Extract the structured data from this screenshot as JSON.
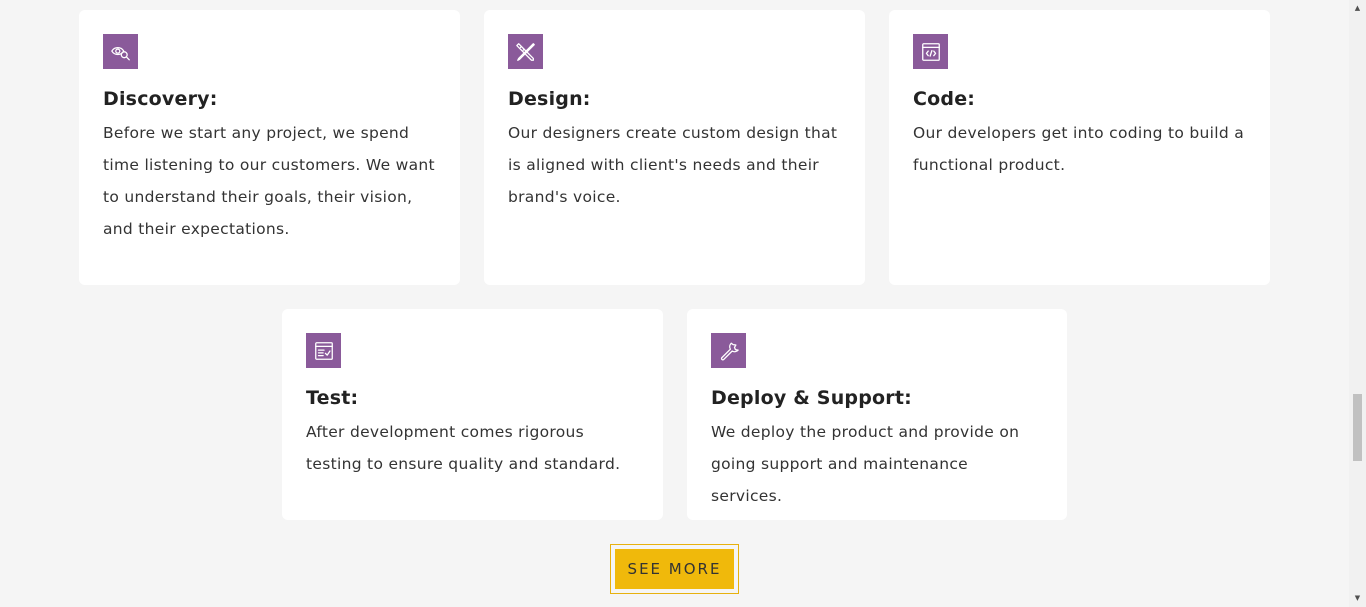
{
  "cards": [
    {
      "icon": "eye-search-icon",
      "title": "Discovery:",
      "description": "Before we start any project, we spend time listening to our customers. We want to understand their goals, their vision, and their expectations."
    },
    {
      "icon": "design-tools-icon",
      "title": "Design:",
      "description": "Our designers create custom design that is aligned with client's needs and their brand's voice."
    },
    {
      "icon": "code-window-icon",
      "title": "Code:",
      "description": "Our developers get into coding to build a functional product."
    },
    {
      "icon": "test-checklist-icon",
      "title": "Test:",
      "description": "After development comes rigorous testing to ensure quality and standard."
    },
    {
      "icon": "wrench-icon",
      "title": "Deploy & Support:",
      "description": "We deploy the product and provide on going support and maintenance services."
    }
  ],
  "see_more_label": "SEE MORE",
  "colors": {
    "icon_bg": "#8a5a9a",
    "button_bg": "#f0b90b",
    "page_bg": "#f5f5f5",
    "card_bg": "#ffffff"
  }
}
